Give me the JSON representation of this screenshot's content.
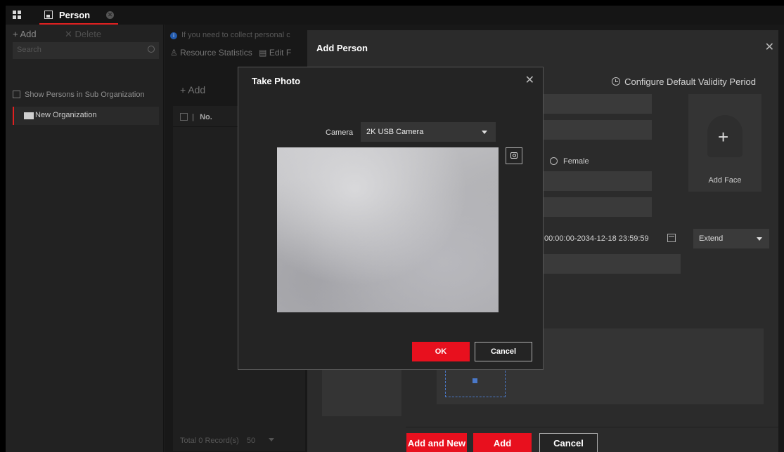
{
  "topbar": {
    "tab_label": "Person"
  },
  "left_panel": {
    "add_label": "+ Add",
    "delete_label": "✕ Delete",
    "search_placeholder": "Search",
    "show_sub_org": "Show Persons in Sub Organization",
    "org_name": "New Organization"
  },
  "middle": {
    "info_text": "If you need to collect personal c",
    "resource_stats": "Resource Statistics",
    "edit_label": "Edit F",
    "add_label": "+ Add",
    "col_no": "No.",
    "total_records": "Total 0 Record(s)",
    "page_size": "50"
  },
  "add_person": {
    "title": "Add Person",
    "close": "✕",
    "configure_validity": "Configure Default Validity Period",
    "add_face": "Add Face",
    "female_label": "Female",
    "validity_range": "00:00:00-2034-12-18 23:59:59",
    "extend_label": "Extend",
    "buttons": {
      "add_and_new": "Add and New",
      "add": "Add",
      "cancel": "Cancel"
    }
  },
  "take_photo": {
    "title": "Take Photo",
    "close": "✕",
    "camera_label": "Camera",
    "camera_value": "2K USB Camera",
    "ok": "OK",
    "cancel": "Cancel"
  },
  "colors": {
    "accent_red": "#e8101e",
    "background": "#1e1e1e",
    "dialog": "#2b2b2b"
  }
}
